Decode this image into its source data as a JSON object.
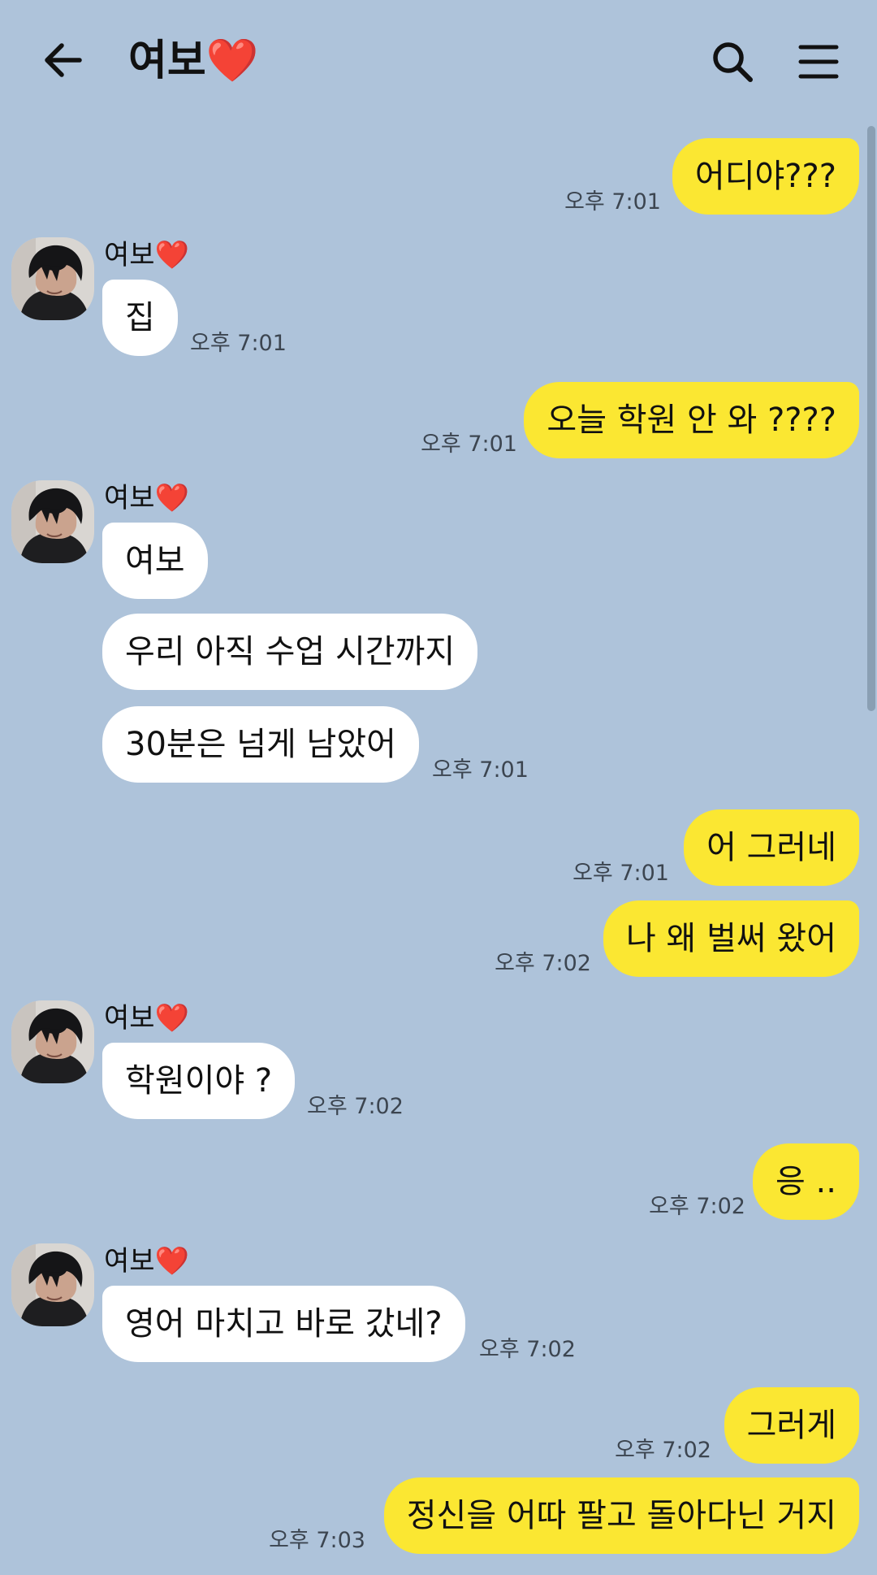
{
  "header": {
    "title": "여보",
    "title_heart": "❤️"
  },
  "icons": {
    "back": "back-arrow-icon",
    "search": "search-icon",
    "menu": "hamburger-menu-icon",
    "heart": "heart-icon"
  },
  "colors": {
    "background": "#aec3da",
    "my_bubble": "#fbe732",
    "their_bubble": "#ffffff",
    "heart": "#ff1a1a"
  },
  "messages": [
    {
      "from": "me",
      "text": "어디야???",
      "time": "오후 7:01"
    },
    {
      "from": "them",
      "sender": "여보",
      "sender_heart": "❤️",
      "text": "집",
      "time": "오후 7:01"
    },
    {
      "from": "me",
      "text": "오늘 학원 안 와 ????",
      "time": "오후 7:01"
    },
    {
      "from": "them",
      "sender": "여보",
      "sender_heart": "❤️",
      "text": "여보"
    },
    {
      "from": "them",
      "text": "우리 아직 수업 시간까지"
    },
    {
      "from": "them",
      "text": "30분은 넘게 남았어",
      "time": "오후 7:01"
    },
    {
      "from": "me",
      "text": "어 그러네",
      "time": "오후 7:01"
    },
    {
      "from": "me",
      "text": "나 왜 벌써 왔어",
      "time": "오후 7:02"
    },
    {
      "from": "them",
      "sender": "여보",
      "sender_heart": "❤️",
      "text": "학원이야 ?",
      "time": "오후 7:02"
    },
    {
      "from": "me",
      "text": "응 ..",
      "time": "오후 7:02"
    },
    {
      "from": "them",
      "sender": "여보",
      "sender_heart": "❤️",
      "text": "영어 마치고 바로 갔네?",
      "time": "오후 7:02"
    },
    {
      "from": "me",
      "text": "그러게",
      "time": "오후 7:02"
    },
    {
      "from": "me",
      "text": "정신을 어따 팔고 돌아다닌 거지",
      "time": "오후 7:03"
    }
  ]
}
